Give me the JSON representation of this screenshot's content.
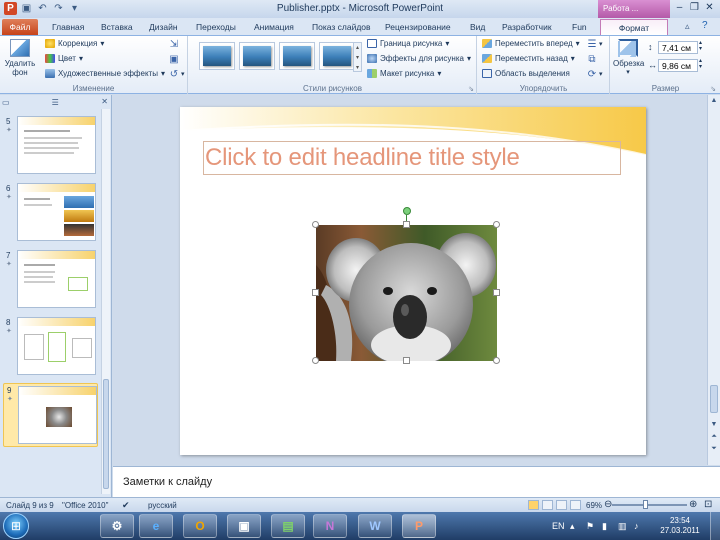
{
  "window": {
    "title": "Publisher.pptx - Microsoft PowerPoint",
    "context_group": "Работа ...",
    "controls": [
      "minimize-icon",
      "restore-icon",
      "close-icon"
    ]
  },
  "tabs": [
    {
      "label": "Файл"
    },
    {
      "label": "Главная"
    },
    {
      "label": "Вставка"
    },
    {
      "label": "Дизайн"
    },
    {
      "label": "Переходы"
    },
    {
      "label": "Анимация"
    },
    {
      "label": "Показ слайдов"
    },
    {
      "label": "Рецензирование"
    },
    {
      "label": "Вид"
    },
    {
      "label": "Разработчик"
    },
    {
      "label": "Fun"
    },
    {
      "label": "Формат"
    }
  ],
  "ribbon": {
    "remove_bg": "Удалить фон",
    "correction": "Коррекция",
    "color": "Цвет",
    "artistic": "Художественные эффекты",
    "group_adjust": "Изменение",
    "group_styles": "Стили рисунков",
    "border": "Граница рисунка",
    "effects": "Эффекты для рисунка",
    "layout": "Макет рисунка",
    "bring_forward": "Переместить вперед",
    "send_backward": "Переместить назад",
    "selection_pane": "Область выделения",
    "group_arrange": "Упорядочить",
    "crop": "Обрезка",
    "height": "7,41 см",
    "width": "9,86 см",
    "group_size": "Размер"
  },
  "slides_panel": {
    "slides": [
      {
        "num": "5"
      },
      {
        "num": "6"
      },
      {
        "num": "7"
      },
      {
        "num": "8"
      },
      {
        "num": "9"
      }
    ]
  },
  "slide": {
    "title_placeholder": "Click to edit headline title style"
  },
  "notes": {
    "placeholder": "Заметки к слайду"
  },
  "status": {
    "slide_count": "Слайд 9 из 9",
    "theme": "\"Office 2010\"",
    "language": "русский",
    "zoom": "69%"
  },
  "taskbar": {
    "apps": [
      {
        "icon": "start-orb-icon"
      },
      {
        "icon": "network-icon"
      },
      {
        "icon": "internet-explorer-icon"
      },
      {
        "icon": "outlook-icon"
      },
      {
        "icon": "remote-desktop-icon"
      },
      {
        "icon": "project-icon"
      },
      {
        "icon": "onenote-icon"
      },
      {
        "icon": "word-icon"
      },
      {
        "icon": "powerpoint-icon"
      }
    ],
    "lang": "EN",
    "time": "23:54",
    "date": "27.03.2011"
  },
  "colors": {
    "accent_file_tab": "#c6431b",
    "context_format": "#b45aa8",
    "title_text": "#e5967a",
    "slide_band": "#f7c948"
  }
}
